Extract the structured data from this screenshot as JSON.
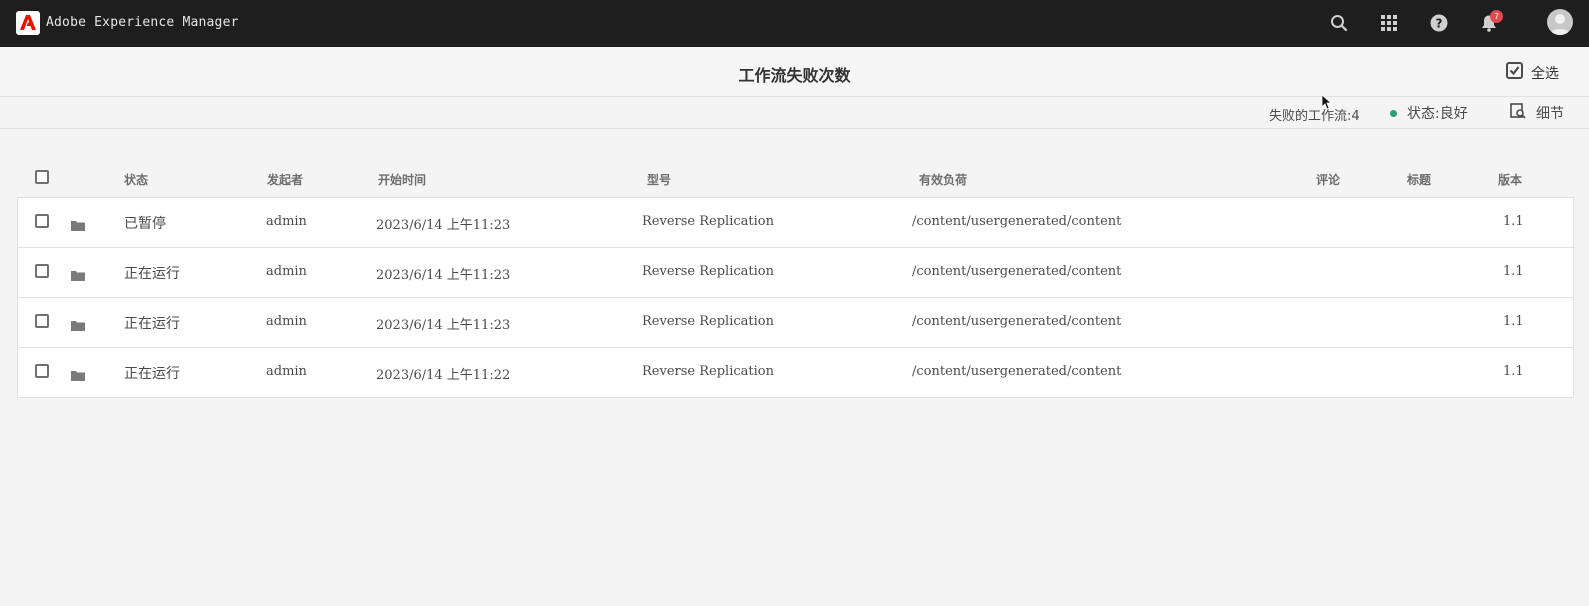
{
  "shell": {
    "app_title": "Adobe Experience Manager",
    "notification_count": "7",
    "icons": [
      "search-icon",
      "apps-grid-icon",
      "help-icon",
      "bell-icon",
      "avatar"
    ]
  },
  "titlebar": {
    "title": "工作流失败次数",
    "select_all_label": "全选"
  },
  "actionbar": {
    "failed_workflows": "失败的工作流:4",
    "status_label": "状态:良好",
    "status_color": "#2d9d78",
    "details_label": "细节"
  },
  "table": {
    "columns": {
      "status": "状态",
      "initiator": "发起者",
      "start_time": "开始时间",
      "model": "型号",
      "payload": "有效负荷",
      "comment": "评论",
      "title": "标题",
      "version": "版本"
    },
    "rows": [
      {
        "status": "已暂停",
        "initiator": "admin",
        "start_time": "2023/6/14 上午11:23",
        "model": "Reverse Replication",
        "payload": "/content/usergenerated/content",
        "version": "1.1"
      },
      {
        "status": "正在运行",
        "initiator": "admin",
        "start_time": "2023/6/14 上午11:23",
        "model": "Reverse Replication",
        "payload": "/content/usergenerated/content",
        "version": "1.1"
      },
      {
        "status": "正在运行",
        "initiator": "admin",
        "start_time": "2023/6/14 上午11:23",
        "model": "Reverse Replication",
        "payload": "/content/usergenerated/content",
        "version": "1.1"
      },
      {
        "status": "正在运行",
        "initiator": "admin",
        "start_time": "2023/6/14 上午11:22",
        "model": "Reverse Replication",
        "payload": "/content/usergenerated/content",
        "version": "1.1"
      }
    ]
  }
}
